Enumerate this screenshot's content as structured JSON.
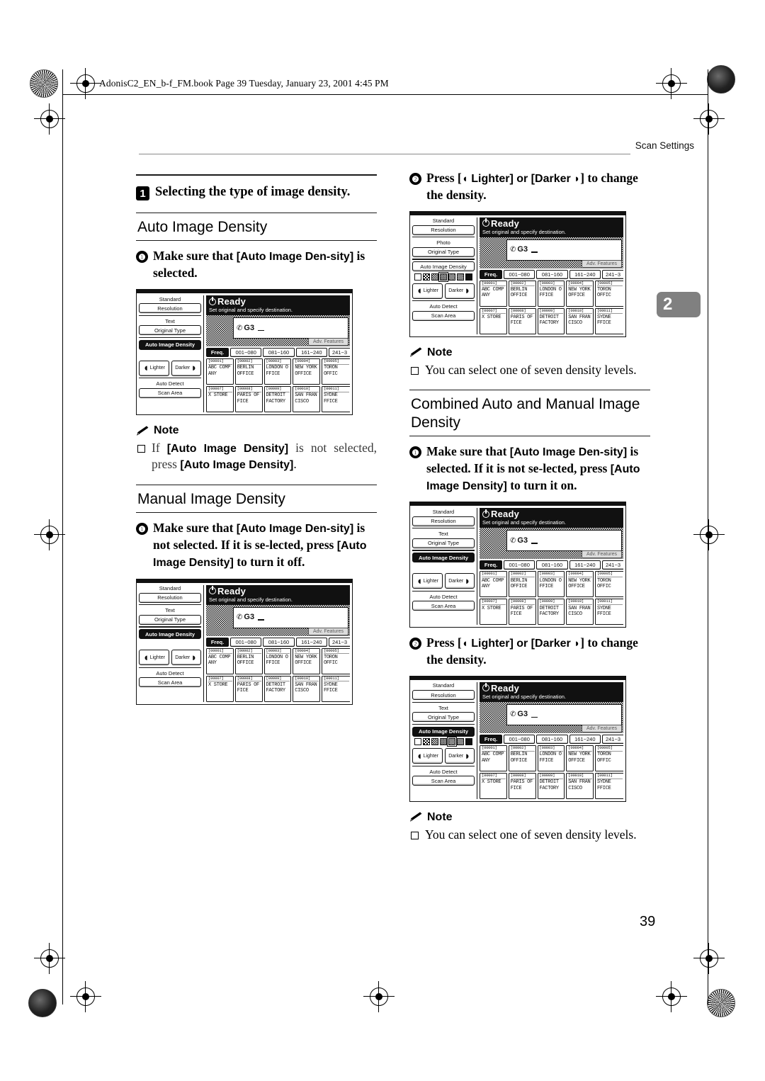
{
  "header": {
    "file_line": "AdonisC2_EN_b-f_FM.book  Page 39  Tuesday, January 23, 2001  4:45 PM",
    "running_head": "Scan Settings",
    "chapter_tab": "2",
    "page_number": "39"
  },
  "left_column": {
    "step1": {
      "num": "1",
      "text": "Selecting the type of image density."
    },
    "auto_heading": "Auto Image Density",
    "auto_step1": {
      "num": "❶",
      "prefix": "Make sure that ",
      "ui1": "[Auto Image Den-sity]",
      "suffix": " is selected."
    },
    "auto_note": {
      "label": "Note",
      "part1": "If ",
      "ui1": "[Auto Image Density]",
      "part2": " is not selected, press ",
      "ui2": "[Auto Image Density]",
      "part3": "."
    },
    "manual_heading": "Manual Image Density",
    "manual_step1": {
      "num": "❶",
      "prefix": "Make sure that ",
      "ui1": "[Auto Image Den-sity]",
      "mid": " is not selected. If it is se-lected, press ",
      "ui2": "[Auto Image Density]",
      "suffix": " to turn it off."
    }
  },
  "right_column": {
    "step2": {
      "num": "❷",
      "prefix": "Press [",
      "lighter": " Lighter] or [Darker ",
      "suffix": "] to change the density."
    },
    "note_seven": {
      "label": "Note",
      "text": "You can select one of seven density levels."
    },
    "combined_heading": "Combined Auto and Manual Image Density",
    "combined_step1": {
      "num": "❶",
      "prefix": "Make sure that ",
      "ui1": "[Auto Image Den-sity]",
      "mid": " is selected. If it is not se-lected, press ",
      "ui2": "[Auto Image Density]",
      "suffix": " to turn it on."
    },
    "combined_step2": {
      "num": "❷",
      "prefix": "Press [",
      "lighter": " Lighter] or [Darker ",
      "suffix": "] to change the density."
    },
    "note_seven2": {
      "label": "Note",
      "text": "You can select one of seven density levels."
    }
  },
  "lcd": {
    "status_title": "Ready",
    "status_sub": "Set original and specify destination.",
    "entry_mode": "G3",
    "adv_features": "Adv. Features",
    "tabs": [
      "Freq.",
      "001~080",
      "081~160",
      "161~240",
      "241~3"
    ],
    "side": {
      "standard": "Standard",
      "resolution": "Resolution",
      "original_type_label_text": "Text",
      "original_type_label_photo": "Photo",
      "original_type": "Original Type",
      "auto_image_density": "Auto Image Density",
      "lighter": "Lighter",
      "darker": "Darker",
      "auto_detect": "Auto Detect",
      "scan_area": "Scan Area"
    },
    "destinations": [
      {
        "id": "[00001]",
        "name": "ABC COMP\nANY"
      },
      {
        "id": "[00002]",
        "name": "BERLIN\nOFFICE"
      },
      {
        "id": "[00003]",
        "name": "LONDON O\nFFICE"
      },
      {
        "id": "[00004]",
        "name": "NEW YORK\nOFFICE"
      },
      {
        "id": "[00005]",
        "name": "TORON\nOFFIC"
      },
      {
        "id": "[00007]",
        "name": "X STORE"
      },
      {
        "id": "[00008]",
        "name": "PARIS OF\nFICE"
      },
      {
        "id": "[00009]",
        "name": "DETROIT\nFACTORY"
      },
      {
        "id": "[00010]",
        "name": "SAN FRAN\nCISCO"
      },
      {
        "id": "[00011]",
        "name": "SYDNE\nFFICE"
      }
    ],
    "screens": {
      "auto": {
        "original_type": "Text",
        "density_on": true,
        "scale_visible": false,
        "scale_selected": null
      },
      "manual": {
        "original_type": "Text",
        "density_on": true,
        "scale_visible": false,
        "scale_selected": null
      },
      "lighter": {
        "original_type": "Photo",
        "density_on": false,
        "scale_visible": true,
        "scale_selected": 3
      },
      "combined1": {
        "original_type": "Text",
        "density_on": true,
        "scale_visible": false,
        "scale_selected": null
      },
      "combined2": {
        "original_type": "Text",
        "density_on": true,
        "scale_visible": true,
        "scale_selected": 4
      }
    },
    "scale_levels": 7
  },
  "colors": {
    "ink": "#000000",
    "paper": "#ffffff",
    "chapter_tab_bg": "#808080",
    "rule": "#1a1a1a"
  }
}
